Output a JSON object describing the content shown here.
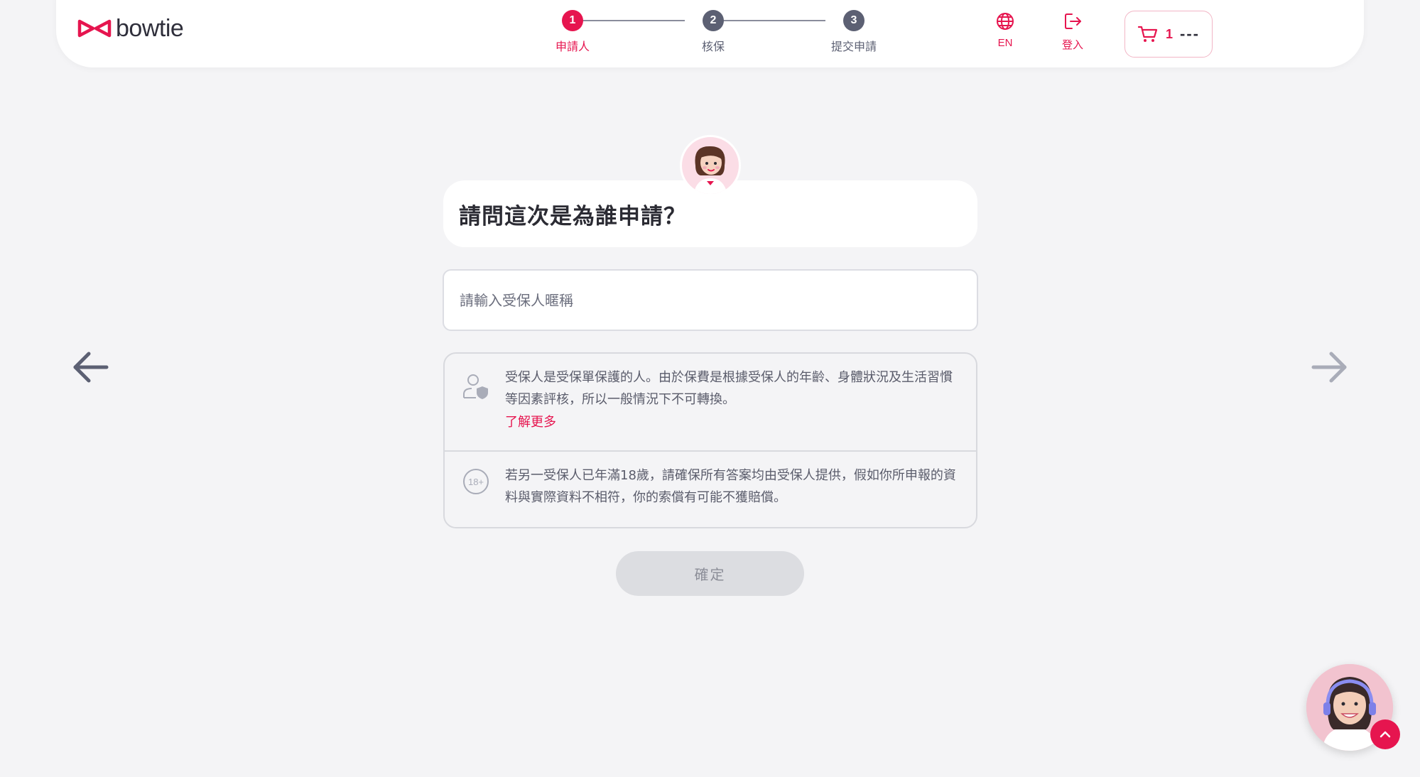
{
  "header": {
    "logo_text": "bowtie",
    "steps": [
      {
        "number": "1",
        "label": "申請人",
        "active": true
      },
      {
        "number": "2",
        "label": "核保",
        "active": false
      },
      {
        "number": "3",
        "label": "提交申請",
        "active": false
      }
    ],
    "cart": {
      "count": "1",
      "total": "---"
    },
    "language_label": "EN",
    "login_label": "登入"
  },
  "main": {
    "question": "請問這次是為誰申請？",
    "name_input_placeholder": "請輸入受保人暱稱",
    "name_input_value": "",
    "info_1": "受保人是受保單保護的人。由於保費是根據受保人的年齡、身體狀況及生活習慣等因素評核，所以一般情況下不可轉換。",
    "learn_more": "了解更多",
    "info_2": "若另一受保人已年滿18歲，請確保所有答案均由受保人提供，假如你所申報的資料與實際資料不相符，你的索償有可能不獲賠償。",
    "info_2_icon_text": "18+",
    "confirm_label": "確定"
  },
  "colors": {
    "brand": "#e6154f",
    "step_inactive": "#5c6073",
    "background": "#f4f4f6"
  },
  "icons": [
    "bowtie-logo-icon",
    "cart-icon",
    "globe-icon",
    "logout-icon",
    "arrow-left-icon",
    "arrow-right-icon",
    "user-shield-icon",
    "age-18-plus-icon",
    "chevron-up-icon"
  ]
}
